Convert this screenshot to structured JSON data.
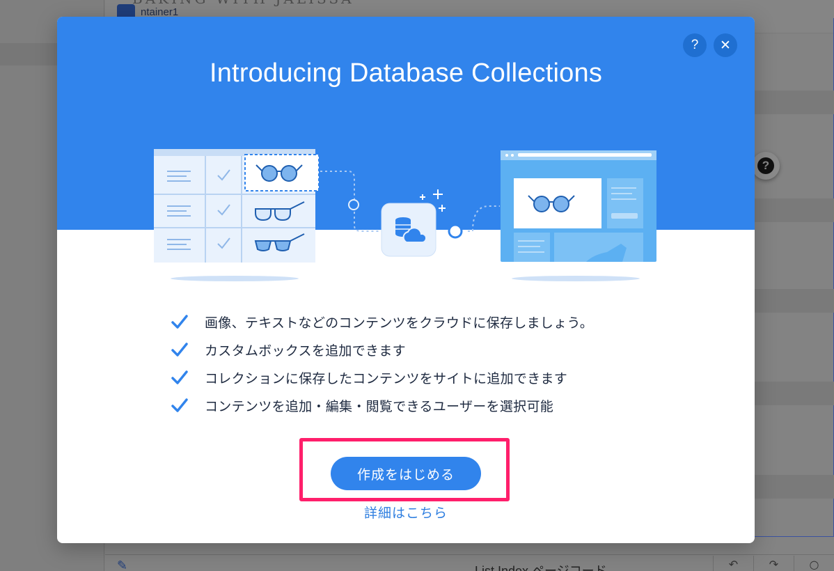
{
  "background": {
    "heading": "BAKING WITH JALISSA",
    "container_label": "ntainer1",
    "bottom_title": "List Index ページコード",
    "help_symbol": "?",
    "bottom_icons": [
      "undo-icon",
      "redo-icon",
      "search-icon"
    ]
  },
  "modal": {
    "title": "Introducing Database Collections",
    "help_symbol": "?",
    "close_symbol": "✕",
    "features": [
      "画像、テキストなどのコンテンツをクラウドに保存しましょう。",
      "カスタムボックスを追加できます",
      "コレクションに保存したコンテンツをサイトに追加できます",
      "コンテンツを追加・編集・閲覧できるユーザーを選択可能"
    ],
    "primary_button": "作成をはじめる",
    "learn_more_link": "詳細はこちら"
  },
  "colors": {
    "accent": "#3184ec",
    "highlight": "#ff1f6b",
    "text": "#1e2a40",
    "link": "#2f7fe0"
  }
}
